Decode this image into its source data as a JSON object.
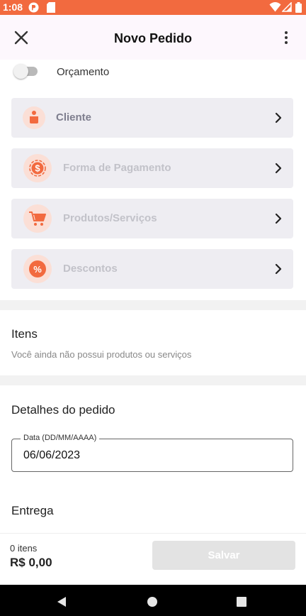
{
  "status_bar": {
    "time": "1:08"
  },
  "header": {
    "title": "Novo Pedido"
  },
  "toggle": {
    "label": "Orçamento",
    "checked": false
  },
  "menu": [
    {
      "label": "Cliente",
      "icon": "person-icon"
    },
    {
      "label": "Forma de Pagamento",
      "icon": "dollar-coin-icon"
    },
    {
      "label": "Produtos/Serviços",
      "icon": "cart-icon"
    },
    {
      "label": "Descontos",
      "icon": "percent-icon"
    }
  ],
  "items": {
    "title": "Itens",
    "empty_text": "Você ainda não possui produtos ou serviços"
  },
  "details": {
    "title": "Detalhes do pedido",
    "date_label": "Data (DD/MM/AAAA)",
    "date_value": "06/06/2023"
  },
  "delivery": {
    "title": "Entrega"
  },
  "footer": {
    "item_count": "0 itens",
    "total": "R$ 0,00",
    "save_label": "Salvar"
  },
  "colors": {
    "accent": "#f26a3f",
    "icon_bg": "#fbdfd6",
    "card_bg": "#eeedf2"
  }
}
